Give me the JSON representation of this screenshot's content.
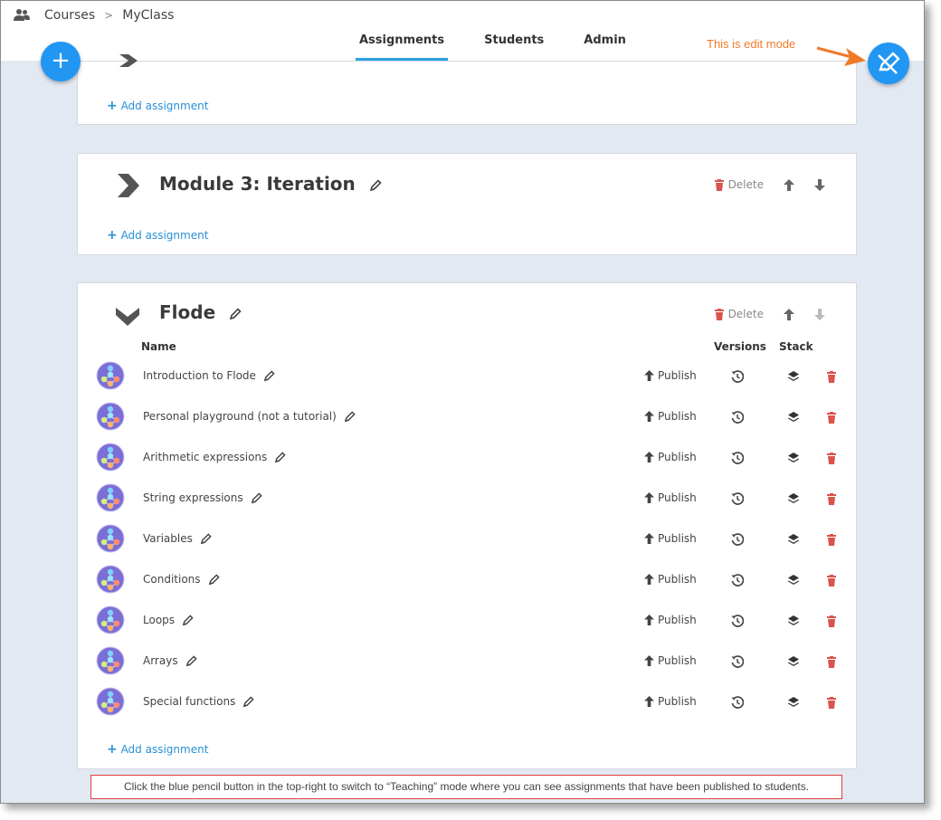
{
  "breadcrumb": {
    "items": [
      "Courses",
      "MyClass"
    ]
  },
  "tabs": [
    {
      "label": "Assignments",
      "active": true
    },
    {
      "label": "Students"
    },
    {
      "label": "Admin"
    }
  ],
  "edit_note": "This is edit mode",
  "add_assignment_label": "Add assignment",
  "module3": {
    "title": "Module 3: Iteration",
    "delete_label": "Delete"
  },
  "flode": {
    "title": "Flode",
    "delete_label": "Delete",
    "columns": {
      "name": "Name",
      "versions": "Versions",
      "stack": "Stack"
    },
    "publish_label": "Publish",
    "assignments": [
      "Introduction to Flode",
      "Personal playground (not a tutorial)",
      "Arithmetic expressions",
      "String expressions",
      "Variables",
      "Conditions",
      "Loops",
      "Arrays",
      "Special functions"
    ]
  },
  "hint": "Click the blue pencil button in the top-right to switch to “Teaching” mode where you can see assignments that have been published to students.",
  "colors": {
    "accent": "#2196f3",
    "delete": "#d9534f",
    "annotation": "#f07a2a",
    "background": "#e3e9f3"
  }
}
